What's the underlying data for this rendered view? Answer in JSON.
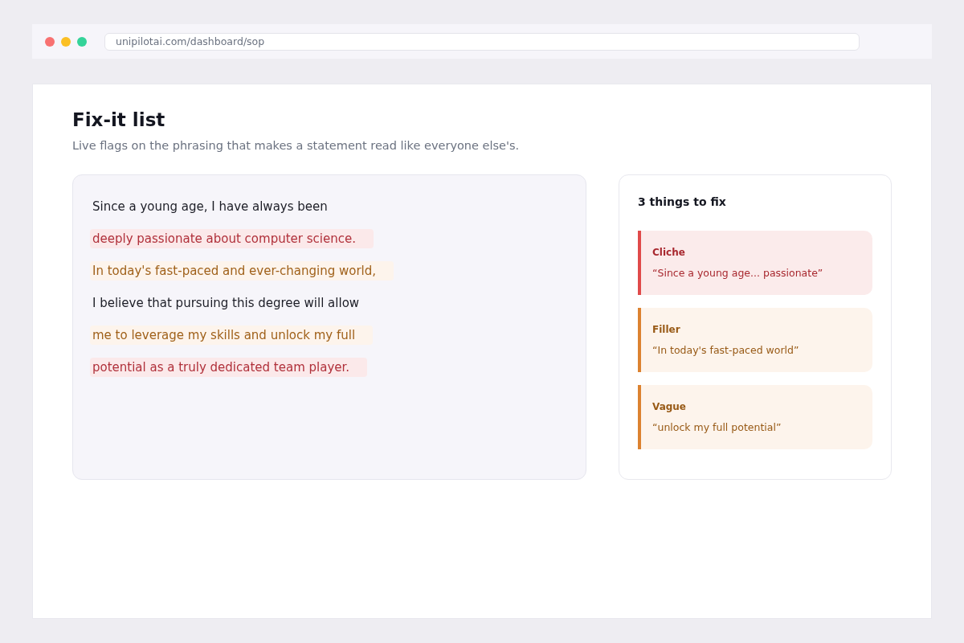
{
  "browser": {
    "url": "unipilotai.com/dashboard/sop"
  },
  "page": {
    "title": "Fix-it list",
    "subtitle": "Live flags on the phrasing that makes a statement read like everyone else's."
  },
  "statement": {
    "lines": [
      {
        "text": "Since a young age, I have always been",
        "kind": "plain"
      },
      {
        "text": "deeply passionate about computer science.",
        "kind": "cliche"
      },
      {
        "text": "In today's fast-paced and ever-changing world,",
        "kind": "filler"
      },
      {
        "text": "I believe that pursuing this degree will allow",
        "kind": "plain"
      },
      {
        "text": "me to leverage my skills and unlock my full",
        "kind": "vague"
      },
      {
        "text": "potential as a truly dedicated team player.",
        "kind": "cliche"
      }
    ]
  },
  "fix_list": {
    "title": "3 things to fix",
    "items": [
      {
        "kind": "cliche",
        "label": "Cliche",
        "quote": "“Since a young age... passionate”"
      },
      {
        "kind": "filler",
        "label": "Filler",
        "quote": "“In today's fast-paced world”"
      },
      {
        "kind": "vague",
        "label": "Vague",
        "quote": "“unlock my full potential”"
      }
    ]
  }
}
